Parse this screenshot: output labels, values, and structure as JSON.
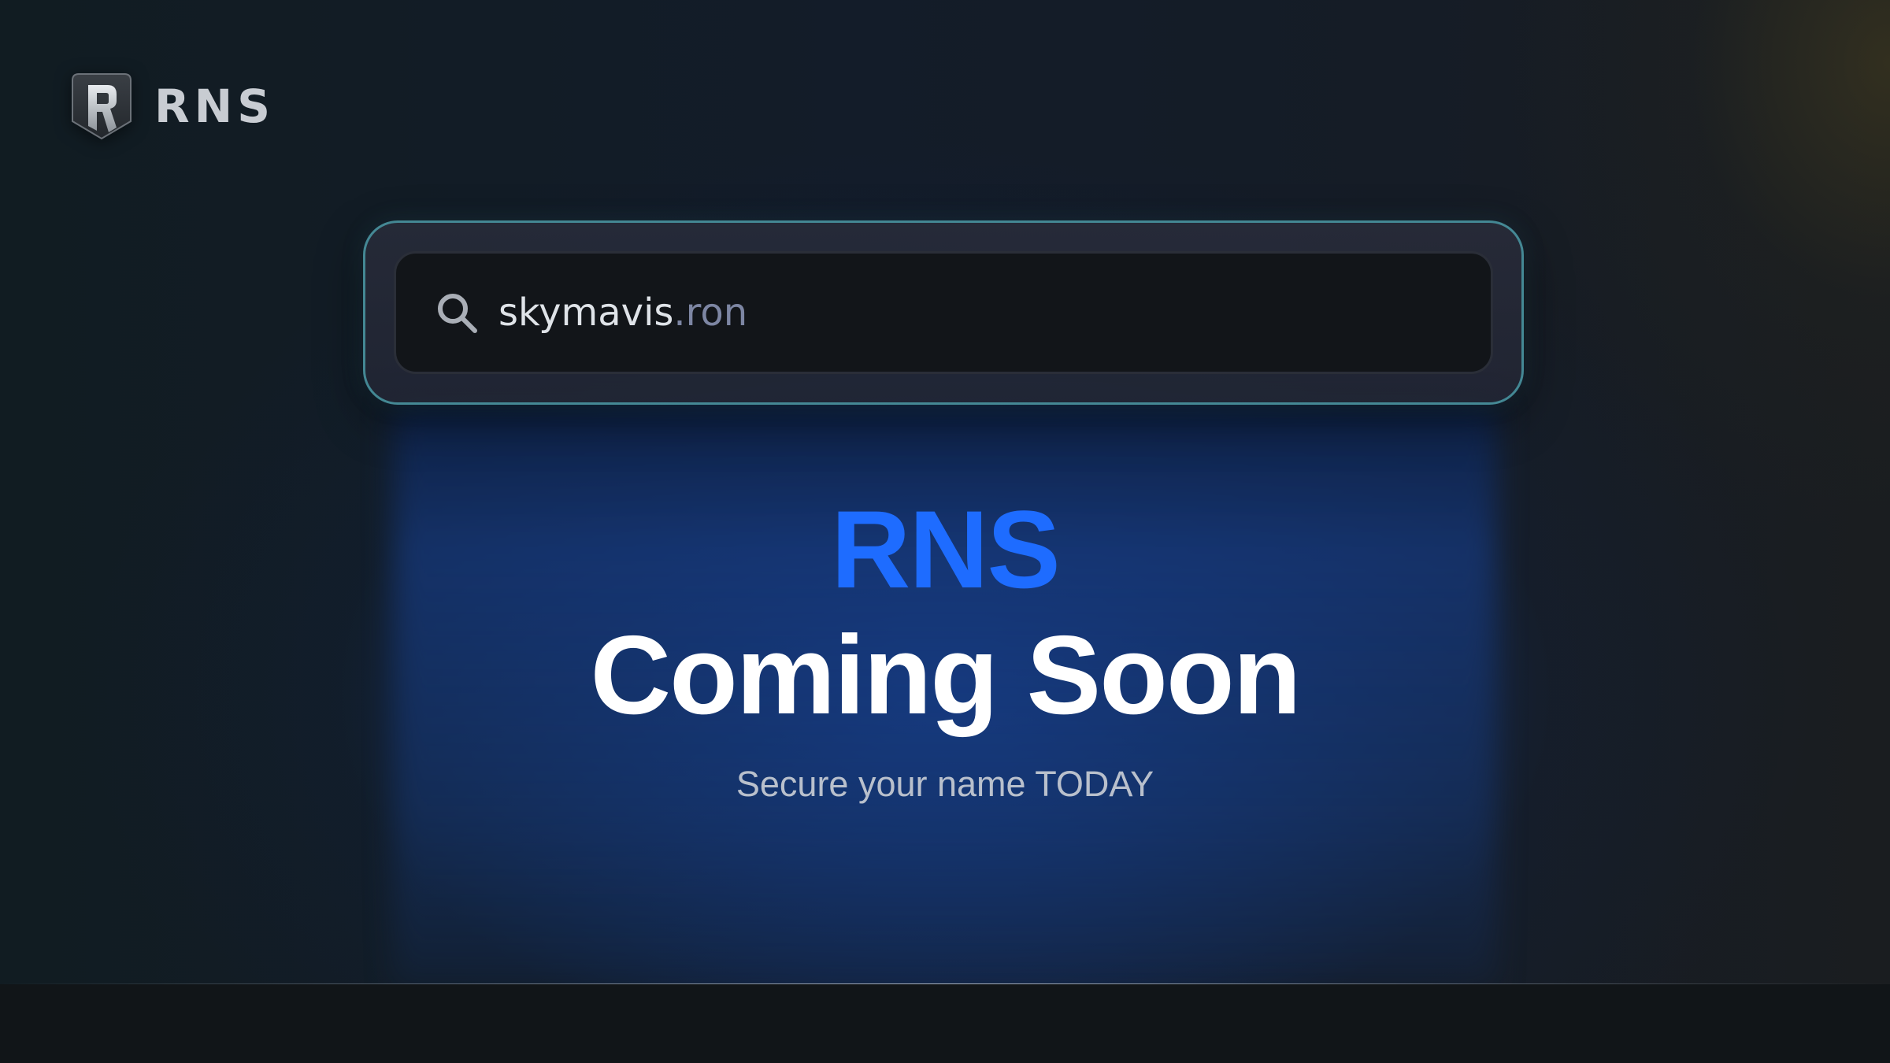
{
  "brand": {
    "name": "RNS",
    "logo_icon": "rns-shield-logo"
  },
  "search": {
    "icon": "search-icon",
    "value_name": "skymavis",
    "value_tld": ".ron"
  },
  "hero": {
    "title_accent": "RNS",
    "title_main": "Coming Soon",
    "subtitle": "Secure your name TODAY"
  },
  "colors": {
    "accent": "#1e6cff",
    "background": "#111518",
    "search_border": "#50aab4",
    "tld_text": "#7d86a3"
  }
}
